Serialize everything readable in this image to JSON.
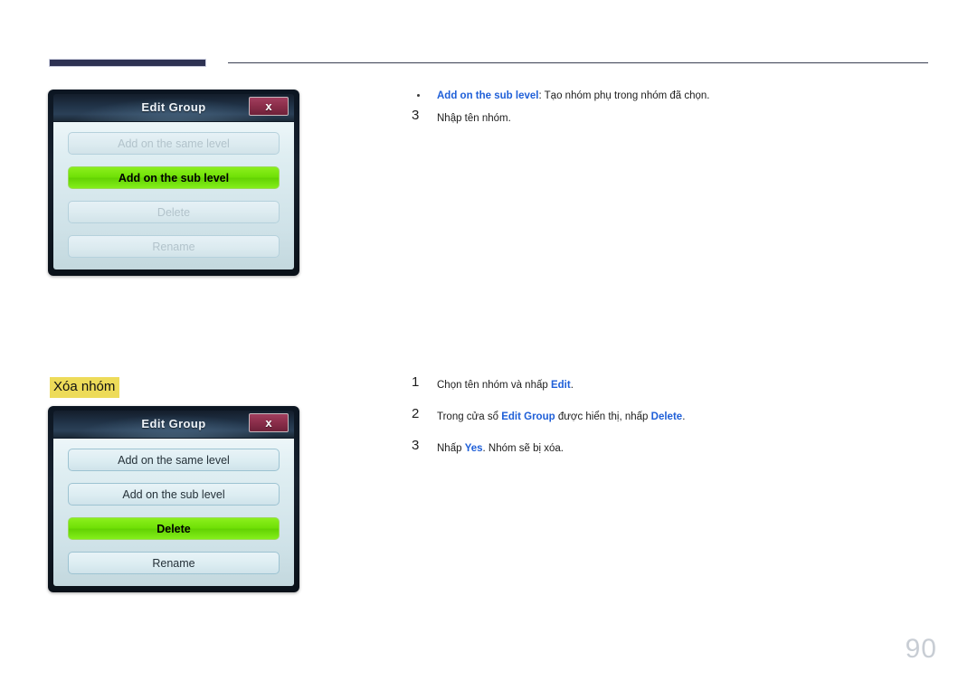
{
  "page": {
    "number": "90",
    "background": "#ffffff"
  },
  "header": {
    "tab_color": "#2e3253",
    "rule_color": "#3a3f52"
  },
  "colors": {
    "accent_link": "#2060d8",
    "highlight_bg": "#eddb59",
    "button_green": "#6fe006",
    "close_button": "#8d2f4c",
    "titlebar": "#22354a"
  },
  "dialogs": [
    {
      "title": "Edit Group",
      "close_label": "x",
      "buttons": [
        {
          "label": "Add on the same level",
          "state": "disabled"
        },
        {
          "label": "Add on the sub level",
          "state": "highlight"
        },
        {
          "label": "Delete",
          "state": "disabled"
        },
        {
          "label": "Rename",
          "state": "disabled"
        }
      ]
    },
    {
      "title": "Edit Group",
      "close_label": "x",
      "buttons": [
        {
          "label": "Add on the same level",
          "state": "normal"
        },
        {
          "label": "Add on the sub level",
          "state": "normal"
        },
        {
          "label": "Delete",
          "state": "highlight"
        },
        {
          "label": "Rename",
          "state": "normal"
        }
      ]
    }
  ],
  "section_heading": "Xóa nhóm",
  "top_notes": {
    "bullet": {
      "keyword": "Add on the sub level",
      "separator": ": ",
      "text": "Tạo nhóm phụ trong nhóm đã chọn."
    },
    "step": {
      "number": "3",
      "text": "Nhập tên nhóm."
    }
  },
  "steps": [
    {
      "number": "1",
      "before": "Chọn tên nhóm và nhấp ",
      "keyword": "Edit",
      "after": "."
    },
    {
      "number": "2",
      "before": "Trong cửa sổ ",
      "keyword": "Edit Group",
      "mid": " được hiển thị, nhấp ",
      "keyword2": "Delete",
      "after": "."
    },
    {
      "number": "3",
      "before": "Nhấp ",
      "keyword": "Yes",
      "after": ". Nhóm sẽ bị xóa."
    }
  ]
}
